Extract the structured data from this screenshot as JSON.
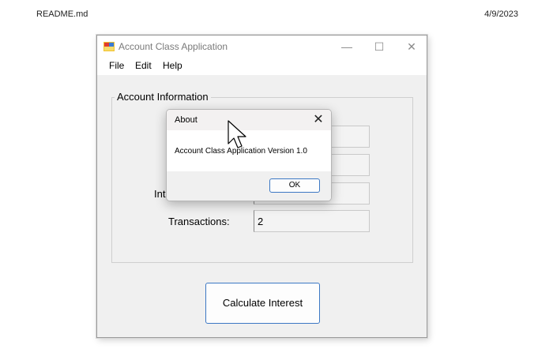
{
  "document": {
    "filename": "README.md",
    "date": "4/9/2023"
  },
  "window": {
    "title": "Account Class Application",
    "controls": {
      "minimize": "—",
      "maximize": "☐",
      "close": "✕"
    }
  },
  "menu": {
    "items": [
      "File",
      "Edit",
      "Help"
    ]
  },
  "account_group": {
    "label": "Account Information",
    "interest_label_partial": "Int",
    "transactions_label": "Transactions:",
    "transactions_value": "2"
  },
  "calculate_button": {
    "label": "Calculate Interest"
  },
  "about_dialog": {
    "title": "About",
    "close": "✕",
    "message": "Account Class Application Version 1.0",
    "ok_label": "OK"
  },
  "colors": {
    "accent": "#3c78c4",
    "window_bg": "#f0f0f0"
  }
}
